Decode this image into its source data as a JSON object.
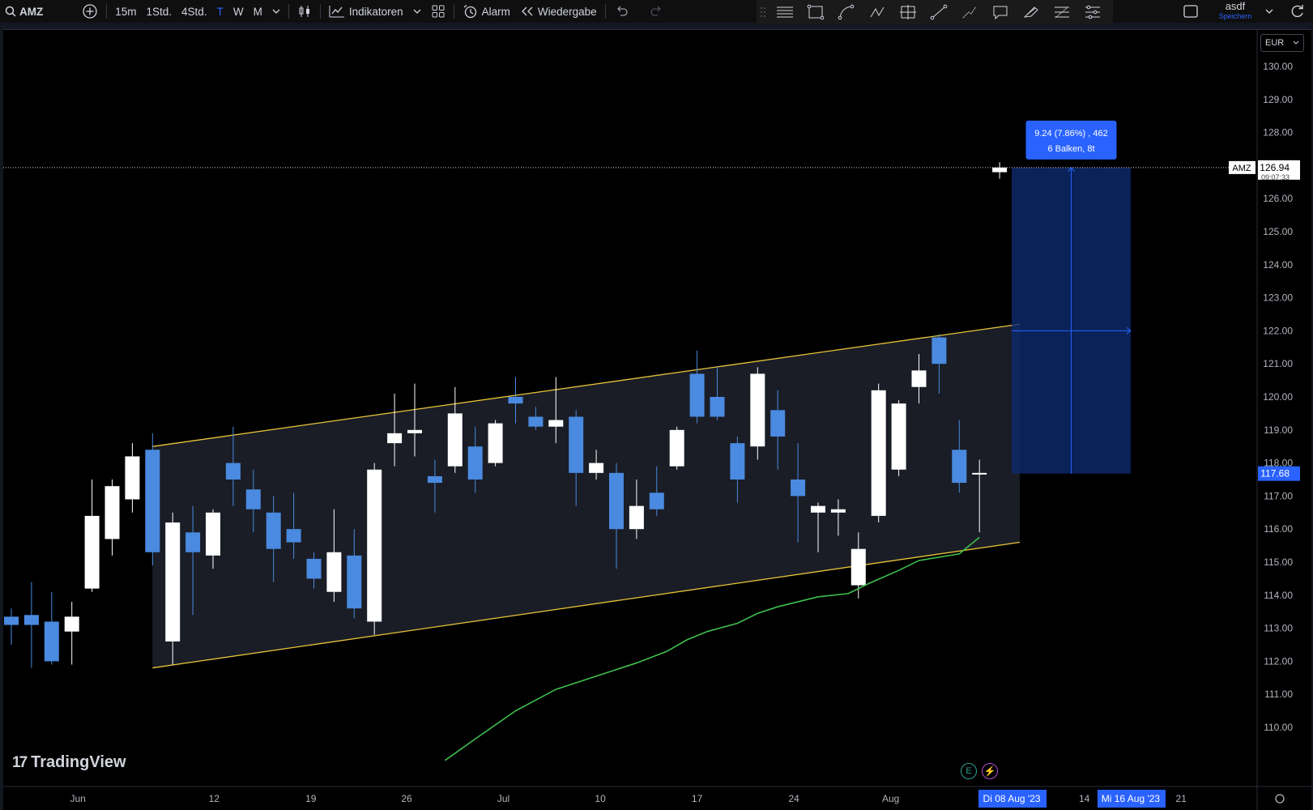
{
  "toolbar": {
    "symbol": "AMZ",
    "intervals": [
      "15m",
      "1Std.",
      "4Std.",
      "T",
      "W",
      "M"
    ],
    "active_interval": "T",
    "indicators_label": "Indikatoren",
    "alert_label": "Alarm",
    "replay_label": "Wiedergabe",
    "layout_name": "asdf",
    "save_label": "Speichern"
  },
  "currency": "EUR",
  "watermark": "TradingView",
  "colors": {
    "background": "#000000",
    "up_candle": "#ffffff",
    "down_candle": "#4a8ae0",
    "channel_line": "#e8c53a",
    "moving_average": "#3fbf4f",
    "measure_box": "#0d2a6e",
    "accent": "#2962ff"
  },
  "chart_data": {
    "type": "candlestick",
    "symbol": "AMZ",
    "x_tick_labels": [
      "Jun",
      "12",
      "19",
      "26",
      "Jul",
      "10",
      "17",
      "24",
      "Aug",
      "14",
      "21"
    ],
    "y_ticks": [
      110.0,
      111.0,
      112.0,
      113.0,
      114.0,
      115.0,
      116.0,
      117.0,
      118.0,
      119.0,
      120.0,
      121.0,
      122.0,
      123.0,
      124.0,
      125.0,
      126.0,
      127.0,
      128.0,
      129.0,
      130.0
    ],
    "y_tick_labels": [
      "110.00",
      "111.00",
      "112.00",
      "113.00",
      "114.00",
      "115.00",
      "116.00",
      "117.00",
      "118.00",
      "119.00",
      "120.00",
      "121.00",
      "122.00",
      "123.00",
      "124.00",
      "125.00",
      "126.00",
      "127.00",
      "128.00",
      "129.00",
      "130.00"
    ],
    "ylim": [
      109.1,
      131.2
    ],
    "candles": [
      {
        "i": 0,
        "o": 113.35,
        "h": 113.6,
        "l": 112.5,
        "c": 113.1
      },
      {
        "i": 1,
        "o": 113.4,
        "h": 114.4,
        "l": 111.8,
        "c": 113.1
      },
      {
        "i": 2,
        "o": 113.2,
        "h": 114.1,
        "l": 111.9,
        "c": 112.0
      },
      {
        "i": 3,
        "o": 112.9,
        "h": 113.8,
        "l": 111.9,
        "c": 113.35
      },
      {
        "i": 4,
        "o": 114.2,
        "h": 117.5,
        "l": 114.1,
        "c": 116.4
      },
      {
        "i": 5,
        "o": 115.7,
        "h": 117.5,
        "l": 115.2,
        "c": 117.3
      },
      {
        "i": 6,
        "o": 116.9,
        "h": 118.6,
        "l": 116.5,
        "c": 118.2
      },
      {
        "i": 7,
        "o": 118.4,
        "h": 118.9,
        "l": 114.9,
        "c": 115.3
      },
      {
        "i": 8,
        "o": 112.6,
        "h": 116.5,
        "l": 111.9,
        "c": 116.2
      },
      {
        "i": 9,
        "o": 115.9,
        "h": 116.7,
        "l": 113.4,
        "c": 115.3
      },
      {
        "i": 10,
        "o": 115.2,
        "h": 116.6,
        "l": 114.8,
        "c": 116.5
      },
      {
        "i": 11,
        "o": 118.0,
        "h": 119.1,
        "l": 116.7,
        "c": 117.5
      },
      {
        "i": 12,
        "o": 117.2,
        "h": 117.8,
        "l": 115.9,
        "c": 116.6
      },
      {
        "i": 13,
        "o": 116.5,
        "h": 117.0,
        "l": 114.4,
        "c": 115.4
      },
      {
        "i": 14,
        "o": 116.0,
        "h": 117.1,
        "l": 115.1,
        "c": 115.6
      },
      {
        "i": 15,
        "o": 115.1,
        "h": 115.3,
        "l": 114.2,
        "c": 114.5
      },
      {
        "i": 16,
        "o": 114.1,
        "h": 116.6,
        "l": 113.8,
        "c": 115.3
      },
      {
        "i": 17,
        "o": 115.2,
        "h": 116.0,
        "l": 113.3,
        "c": 113.6
      },
      {
        "i": 18,
        "o": 113.2,
        "h": 118.0,
        "l": 112.8,
        "c": 117.8
      },
      {
        "i": 19,
        "o": 118.6,
        "h": 120.1,
        "l": 117.9,
        "c": 118.9
      },
      {
        "i": 20,
        "o": 118.9,
        "h": 120.4,
        "l": 118.2,
        "c": 119.0
      },
      {
        "i": 21,
        "o": 117.6,
        "h": 118.1,
        "l": 116.5,
        "c": 117.4
      },
      {
        "i": 22,
        "o": 117.9,
        "h": 120.3,
        "l": 117.7,
        "c": 119.5
      },
      {
        "i": 23,
        "o": 118.5,
        "h": 119.1,
        "l": 117.1,
        "c": 117.5
      },
      {
        "i": 24,
        "o": 118.0,
        "h": 119.3,
        "l": 117.9,
        "c": 119.2
      },
      {
        "i": 25,
        "o": 120.0,
        "h": 120.6,
        "l": 119.2,
        "c": 119.8
      },
      {
        "i": 26,
        "o": 119.4,
        "h": 119.7,
        "l": 119.0,
        "c": 119.1
      },
      {
        "i": 27,
        "o": 119.1,
        "h": 120.6,
        "l": 118.6,
        "c": 119.3
      },
      {
        "i": 28,
        "o": 119.4,
        "h": 119.6,
        "l": 116.7,
        "c": 117.7
      },
      {
        "i": 29,
        "o": 117.7,
        "h": 118.4,
        "l": 117.5,
        "c": 118.0
      },
      {
        "i": 30,
        "o": 117.7,
        "h": 118.0,
        "l": 114.8,
        "c": 116.0
      },
      {
        "i": 31,
        "o": 116.0,
        "h": 117.5,
        "l": 115.7,
        "c": 116.7
      },
      {
        "i": 32,
        "o": 117.1,
        "h": 117.9,
        "l": 116.4,
        "c": 116.6
      },
      {
        "i": 33,
        "o": 117.9,
        "h": 119.1,
        "l": 117.8,
        "c": 119.0
      },
      {
        "i": 34,
        "o": 120.7,
        "h": 121.4,
        "l": 119.2,
        "c": 119.4
      },
      {
        "i": 35,
        "o": 120.0,
        "h": 120.9,
        "l": 119.3,
        "c": 119.4
      },
      {
        "i": 36,
        "o": 118.6,
        "h": 118.8,
        "l": 116.8,
        "c": 117.5
      },
      {
        "i": 37,
        "o": 118.5,
        "h": 120.9,
        "l": 118.1,
        "c": 120.7
      },
      {
        "i": 38,
        "o": 119.6,
        "h": 120.2,
        "l": 117.8,
        "c": 118.8
      },
      {
        "i": 39,
        "o": 117.5,
        "h": 118.6,
        "l": 115.6,
        "c": 117.0
      },
      {
        "i": 40,
        "o": 116.5,
        "h": 116.8,
        "l": 115.3,
        "c": 116.7
      },
      {
        "i": 41,
        "o": 116.5,
        "h": 116.9,
        "l": 115.8,
        "c": 116.6
      },
      {
        "i": 42,
        "o": 114.3,
        "h": 115.9,
        "l": 113.9,
        "c": 115.4
      },
      {
        "i": 43,
        "o": 116.4,
        "h": 120.4,
        "l": 116.2,
        "c": 120.2
      },
      {
        "i": 44,
        "o": 117.8,
        "h": 119.9,
        "l": 117.6,
        "c": 119.8
      },
      {
        "i": 45,
        "o": 120.3,
        "h": 121.3,
        "l": 119.8,
        "c": 120.8
      },
      {
        "i": 46,
        "o": 121.8,
        "h": 121.9,
        "l": 120.1,
        "c": 121.0
      },
      {
        "i": 47,
        "o": 118.4,
        "h": 119.3,
        "l": 117.1,
        "c": 117.4
      },
      {
        "i": 48,
        "o": 117.7,
        "h": 118.1,
        "l": 115.9,
        "c": 117.7
      },
      {
        "i": 49,
        "o": 126.8,
        "h": 127.1,
        "l": 126.6,
        "c": 126.94
      }
    ],
    "moving_average": {
      "name": "",
      "points": [
        [
          21.5,
          109.0
        ],
        [
          23.0,
          109.65
        ],
        [
          25.0,
          110.5
        ],
        [
          27.0,
          111.15
        ],
        [
          29.0,
          111.55
        ],
        [
          31.0,
          111.95
        ],
        [
          32.5,
          112.3
        ],
        [
          33.5,
          112.65
        ],
        [
          34.5,
          112.9
        ],
        [
          36.0,
          113.15
        ],
        [
          37.0,
          113.45
        ],
        [
          38.0,
          113.65
        ],
        [
          40.0,
          113.95
        ],
        [
          41.5,
          114.05
        ],
        [
          42.5,
          114.35
        ],
        [
          44.0,
          114.75
        ],
        [
          45.0,
          115.05
        ],
        [
          47.0,
          115.25
        ],
        [
          48.0,
          115.75
        ]
      ]
    },
    "channel": {
      "upper": [
        [
          7.0,
          118.5
        ],
        [
          50.0,
          122.2
        ]
      ],
      "lower": [
        [
          7.0,
          111.8
        ],
        [
          50.0,
          115.6
        ]
      ]
    },
    "measure": {
      "label_line1": "9.24 (7.86%) , 462",
      "label_line2": "6 Balken, 8t",
      "from_price": 117.68,
      "to_price": 126.94
    },
    "last_price": {
      "label": "AMZ",
      "value": "126.94",
      "countdown": "09:07:33"
    },
    "crosshair_price": "117.68",
    "date_labels": [
      "Di 08 Aug '23",
      "Mi 16 Aug '23"
    ]
  }
}
